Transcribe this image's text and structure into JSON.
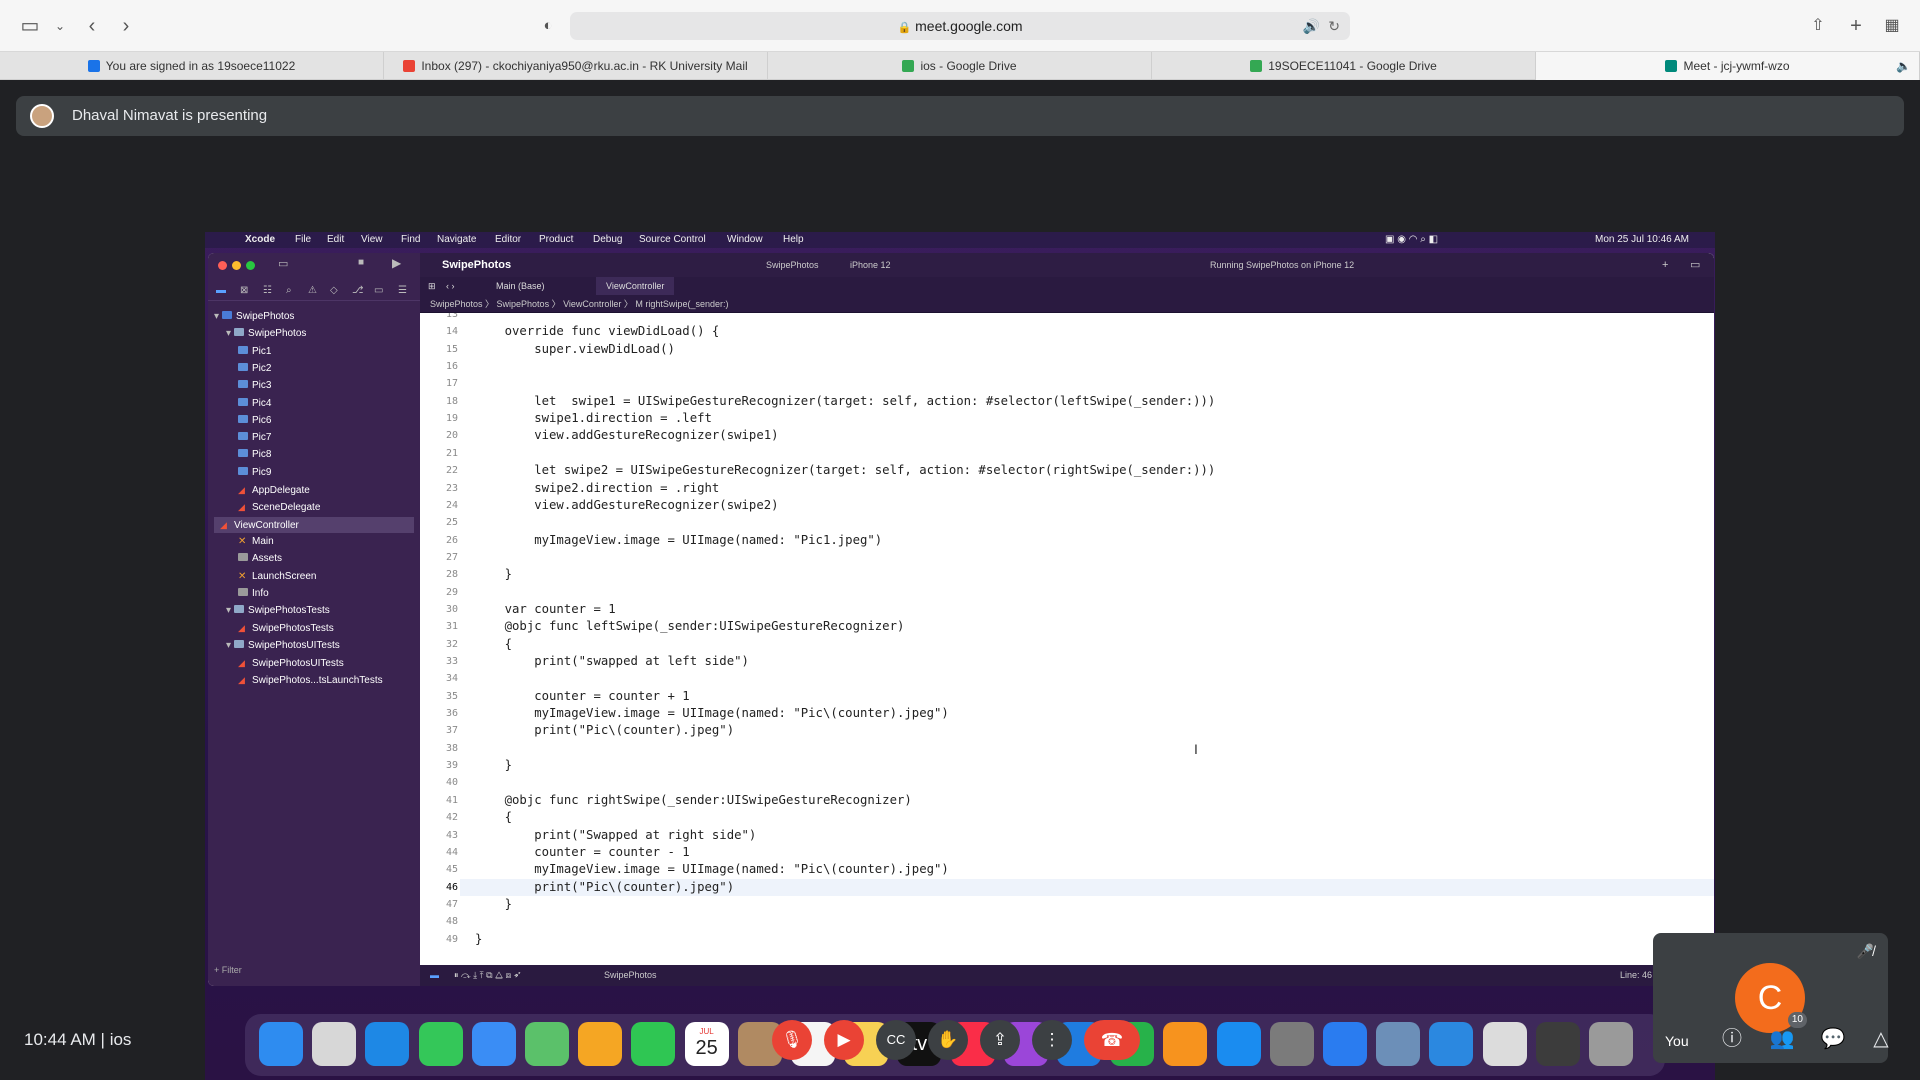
{
  "browser": {
    "url": "meet.google.com",
    "tabs": [
      {
        "label": "You are signed in as 19soece11022",
        "favicon_color": "#1a73e8"
      },
      {
        "label": "Inbox (297) - ckochiyaniya950@rku.ac.in - RK University Mail",
        "favicon_color": "#ea4335"
      },
      {
        "label": "ios - Google Drive",
        "favicon_color": "#34a853"
      },
      {
        "label": "19SOECE11041 - Google Drive",
        "favicon_color": "#34a853"
      },
      {
        "label": "Meet - jcj-ywmf-wzo",
        "favicon_color": "#00897b"
      }
    ]
  },
  "meet": {
    "presenting_text": "Dhaval Nimavat is presenting",
    "clock": "10:44 AM",
    "meeting_name": "ios",
    "participant_count": "10",
    "self_initial": "C",
    "self_label": "You",
    "colors": {
      "end_call": "#ea4335",
      "avatar": "#f36c1c"
    }
  },
  "shared": {
    "menubar": {
      "app": "Xcode",
      "items": [
        "File",
        "Edit",
        "View",
        "Find",
        "Navigate",
        "Editor",
        "Product",
        "Debug",
        "Source Control",
        "Window",
        "Help"
      ],
      "datetime": "Mon 25 Jul  10:46 AM"
    },
    "xcode": {
      "project": "SwipePhotos",
      "scheme": "SwipePhotos",
      "device": "iPhone 12",
      "status": "Running SwipePhotos on iPhone 12",
      "tabs": [
        "Main (Base)",
        "ViewController"
      ],
      "breadcrumb": "SwipePhotos  〉 SwipePhotos 〉 ViewController 〉 M  rightSwipe(_sender:)",
      "filter_placeholder": "Filter",
      "bottom_scheme": "SwipePhotos",
      "line_indicator": "Line: 46",
      "navigator": [
        {
          "label": "SwipePhotos",
          "kind": "proj",
          "indent": 0,
          "disclosure": "⌄"
        },
        {
          "label": "SwipePhotos",
          "kind": "folder",
          "indent": 1,
          "disclosure": "⌄"
        },
        {
          "label": "Pic1",
          "kind": "img",
          "indent": 2
        },
        {
          "label": "Pic2",
          "kind": "img",
          "indent": 2
        },
        {
          "label": "Pic3",
          "kind": "img",
          "indent": 2
        },
        {
          "label": "Pic4",
          "kind": "img",
          "indent": 2
        },
        {
          "label": "Pic6",
          "kind": "img",
          "indent": 2
        },
        {
          "label": "Pic7",
          "kind": "img",
          "indent": 2
        },
        {
          "label": "Pic8",
          "kind": "img",
          "indent": 2
        },
        {
          "label": "Pic9",
          "kind": "img",
          "indent": 2
        },
        {
          "label": "AppDelegate",
          "kind": "swift",
          "indent": 2
        },
        {
          "label": "SceneDelegate",
          "kind": "swift",
          "indent": 2
        },
        {
          "label": "ViewController",
          "kind": "swift",
          "indent": 2,
          "selected": true
        },
        {
          "label": "Main",
          "kind": "x",
          "indent": 2
        },
        {
          "label": "Assets",
          "kind": "grid",
          "indent": 2
        },
        {
          "label": "LaunchScreen",
          "kind": "x",
          "indent": 2
        },
        {
          "label": "Info",
          "kind": "grid",
          "indent": 2
        },
        {
          "label": "SwipePhotosTests",
          "kind": "folder",
          "indent": 1,
          "disclosure": "⌄"
        },
        {
          "label": "SwipePhotosTests",
          "kind": "swift",
          "indent": 2
        },
        {
          "label": "SwipePhotosUITests",
          "kind": "folder",
          "indent": 1,
          "disclosure": "⌄"
        },
        {
          "label": "SwipePhotosUITests",
          "kind": "swift",
          "indent": 2
        },
        {
          "label": "SwipePhotos...tsLaunchTests",
          "kind": "swift",
          "indent": 2
        }
      ],
      "code_lines": [
        {
          "n": "13",
          "t": ""
        },
        {
          "n": "14",
          "t": "    override func viewDidLoad() {"
        },
        {
          "n": "15",
          "t": "        super.viewDidLoad()"
        },
        {
          "n": "16",
          "t": ""
        },
        {
          "n": "17",
          "t": ""
        },
        {
          "n": "18",
          "t": "        let  swipe1 = UISwipeGestureRecognizer(target: self, action: #selector(leftSwipe(_sender:)))"
        },
        {
          "n": "19",
          "t": "        swipe1.direction = .left"
        },
        {
          "n": "20",
          "t": "        view.addGestureRecognizer(swipe1)"
        },
        {
          "n": "21",
          "t": ""
        },
        {
          "n": "22",
          "t": "        let swipe2 = UISwipeGestureRecognizer(target: self, action: #selector(rightSwipe(_sender:)))"
        },
        {
          "n": "23",
          "t": "        swipe2.direction = .right"
        },
        {
          "n": "24",
          "t": "        view.addGestureRecognizer(swipe2)"
        },
        {
          "n": "25",
          "t": ""
        },
        {
          "n": "26",
          "t": "        myImageView.image = UIImage(named: \"Pic1.jpeg\")"
        },
        {
          "n": "27",
          "t": ""
        },
        {
          "n": "28",
          "t": "    }"
        },
        {
          "n": "29",
          "t": ""
        },
        {
          "n": "30",
          "t": "    var counter = 1"
        },
        {
          "n": "31",
          "t": "    @objc func leftSwipe(_sender:UISwipeGestureRecognizer)"
        },
        {
          "n": "32",
          "t": "    {"
        },
        {
          "n": "33",
          "t": "        print(\"swapped at left side\")"
        },
        {
          "n": "34",
          "t": ""
        },
        {
          "n": "35",
          "t": "        counter = counter + 1"
        },
        {
          "n": "36",
          "t": "        myImageView.image = UIImage(named: \"Pic\\(counter).jpeg\")"
        },
        {
          "n": "37",
          "t": "        print(\"Pic\\(counter).jpeg\")"
        },
        {
          "n": "38",
          "t": ""
        },
        {
          "n": "39",
          "t": "    }"
        },
        {
          "n": "40",
          "t": ""
        },
        {
          "n": "41",
          "t": "    @objc func rightSwipe(_sender:UISwipeGestureRecognizer)"
        },
        {
          "n": "42",
          "t": "    {"
        },
        {
          "n": "43",
          "t": "        print(\"Swapped at right side\")"
        },
        {
          "n": "44",
          "t": "        counter = counter - 1"
        },
        {
          "n": "45",
          "t": "        myImageView.image = UIImage(named: \"Pic\\(counter).jpeg\")"
        },
        {
          "n": "46",
          "t": "        print(\"Pic\\(counter).jpeg\")",
          "current": true
        },
        {
          "n": "47",
          "t": "    }"
        },
        {
          "n": "48",
          "t": ""
        },
        {
          "n": "49",
          "t": "}"
        }
      ]
    },
    "dock_apps": [
      {
        "name": "finder-icon",
        "color": "#2e8cf0"
      },
      {
        "name": "launchpad-icon",
        "color": "#d7d7d7"
      },
      {
        "name": "safari-icon",
        "color": "#1e88e5"
      },
      {
        "name": "messages-icon",
        "color": "#34c759"
      },
      {
        "name": "mail-icon",
        "color": "#3a8df5"
      },
      {
        "name": "maps-icon",
        "color": "#5bc16a"
      },
      {
        "name": "photos-icon",
        "color": "#f5a623"
      },
      {
        "name": "facetime-icon",
        "color": "#2fc653"
      },
      {
        "name": "calendar-icon",
        "color": "#ffffff",
        "text": "25",
        "sub": "JUL"
      },
      {
        "name": "contacts-icon",
        "color": "#b08a62"
      },
      {
        "name": "reminders-icon",
        "color": "#f5f5f5"
      },
      {
        "name": "notes-icon",
        "color": "#f7d154"
      },
      {
        "name": "tv-icon",
        "color": "#111111",
        "text": "tv"
      },
      {
        "name": "music-icon",
        "color": "#fa2d48"
      },
      {
        "name": "podcasts-icon",
        "color": "#9b46d9"
      },
      {
        "name": "keynote-icon",
        "color": "#1f7ce0"
      },
      {
        "name": "numbers-icon",
        "color": "#27b24a"
      },
      {
        "name": "pages-icon",
        "color": "#f7931e"
      },
      {
        "name": "appstore-icon",
        "color": "#1a8cf0"
      },
      {
        "name": "system-preferences-icon",
        "color": "#7b7b7b"
      },
      {
        "name": "xcode-icon",
        "color": "#2a7cf0"
      },
      {
        "name": "preview-icon",
        "color": "#6c8fb8"
      },
      {
        "name": "simulator-icon",
        "color": "#2b88e0"
      },
      {
        "name": "documents-icon",
        "color": "#dcdcdc"
      },
      {
        "name": "downloads-icon",
        "color": "#3c3c3c"
      },
      {
        "name": "trash-icon",
        "color": "#9a9a9a"
      }
    ]
  }
}
